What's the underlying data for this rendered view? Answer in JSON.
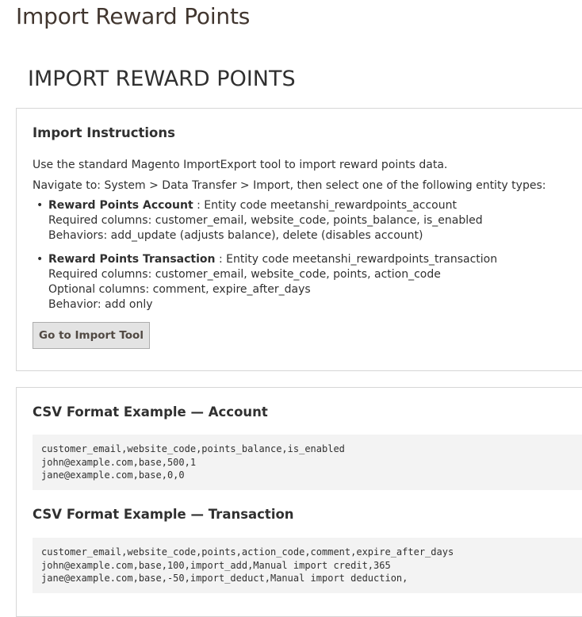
{
  "page": {
    "title": "Import Reward Points"
  },
  "section": {
    "title": "IMPORT REWARD POINTS"
  },
  "instructions": {
    "heading": "Import Instructions",
    "intro": "Use the standard Magento ImportExport tool to import reward points data.",
    "navigate": "Navigate to: System > Data Transfer > Import, then select one of the following entity types:",
    "entities": [
      {
        "name": "Reward Points Account",
        "code_line": " : Entity code meetanshi_rewardpoints_account",
        "lines": [
          "Required columns: customer_email, website_code, points_balance, is_enabled",
          "Behaviors: add_update (adjusts balance), delete (disables account)"
        ]
      },
      {
        "name": "Reward Points Transaction",
        "code_line": " : Entity code meetanshi_rewardpoints_transaction",
        "lines": [
          "Required columns: customer_email, website_code, points, action_code",
          "Optional columns: comment, expire_after_days",
          "Behavior: add only"
        ]
      }
    ],
    "button_label": "Go to Import Tool"
  },
  "csv": {
    "account_heading": "CSV Format Example — Account",
    "account_code": "customer_email,website_code,points_balance,is_enabled\njohn@example.com,base,500,1\njane@example.com,base,0,0",
    "transaction_heading": "CSV Format Example — Transaction",
    "transaction_code": "customer_email,website_code,points,action_code,comment,expire_after_days\njohn@example.com,base,100,import_add,Manual import credit,365\njane@example.com,base,-50,import_deduct,Manual import deduction,"
  }
}
